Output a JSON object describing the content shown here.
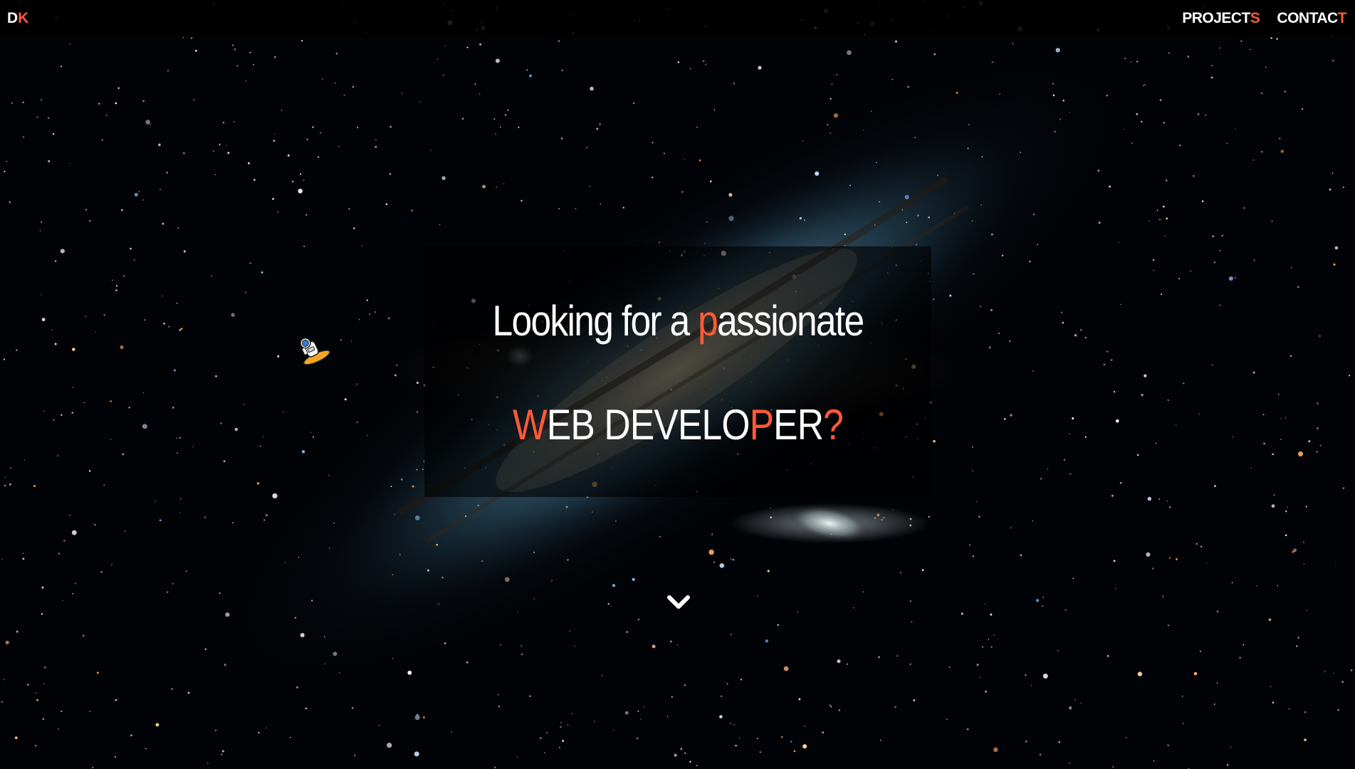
{
  "navbar": {
    "logo": {
      "main": "D",
      "accent": "K"
    },
    "links": [
      {
        "main": "PROJECT",
        "accent": "S"
      },
      {
        "main": "CONTAC",
        "accent": "T"
      }
    ]
  },
  "hero": {
    "line1": {
      "before": "Looking for a ",
      "accent": "p",
      "after": "assionate"
    },
    "line2": {
      "a1": "W",
      "t1": "EB DEVELO",
      "a2": "P",
      "t2": "ER",
      "a3": "?"
    }
  },
  "icons": {
    "scroll": "chevron-down-icon",
    "astronaut": "astronaut-icon"
  },
  "colors": {
    "accent": "#ff5a36",
    "text": "#ffffff",
    "navbar": "#000000",
    "background": "#020307"
  }
}
